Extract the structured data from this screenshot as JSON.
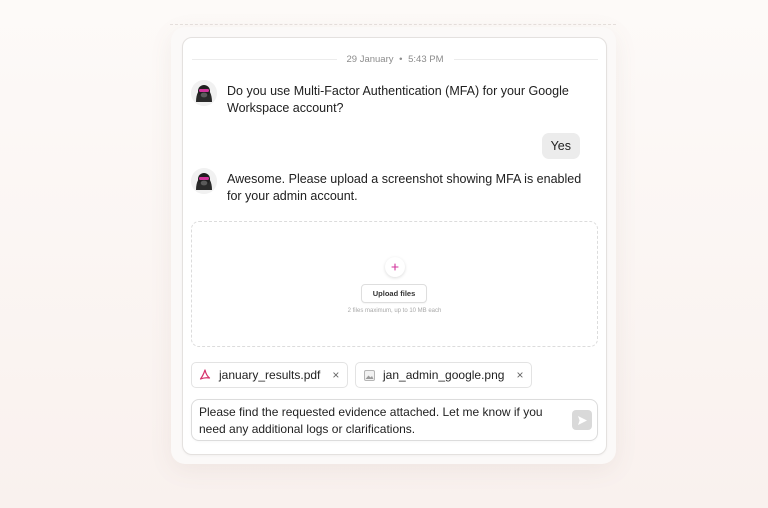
{
  "conversation": {
    "date": "29 January",
    "separator": "•",
    "time": "5:43 PM"
  },
  "messages": [
    {
      "sender": "bot",
      "text": "Do you use Multi-Factor Authentication (MFA) for your Google Workspace account?"
    },
    {
      "sender": "user",
      "text": "Yes"
    },
    {
      "sender": "bot",
      "text": "Awesome. Please upload a screenshot showing MFA is enabled for your admin account."
    }
  ],
  "upload": {
    "button_label": "Upload files",
    "hint": "2 files maximum, up to 10 MB each"
  },
  "attachments": [
    {
      "name": "january_results.pdf",
      "icon": "pdf-icon",
      "remove": "×"
    },
    {
      "name": "jan_admin_google.png",
      "icon": "image-icon",
      "remove": "×"
    }
  ],
  "composer": {
    "value": "Please find the requested evidence attached. Let me know if you need any additional logs or clarifications.",
    "send_icon": "send-icon"
  },
  "colors": {
    "avatar_accent": "#d1339b",
    "pdf_icon": "#d6336c",
    "send_button": "#d9d9d9"
  }
}
